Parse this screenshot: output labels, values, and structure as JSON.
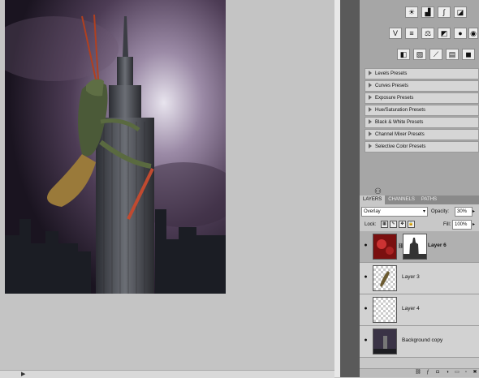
{
  "adjustments": {
    "row1": [
      "brightness-icon",
      "levels-icon",
      "curves-icon",
      "exposure-icon"
    ],
    "row2": [
      "vibrance-icon",
      "hue-saturation-icon",
      "color-balance-icon",
      "black-white-icon",
      "photo-filter-icon",
      "channel-mixer-icon"
    ],
    "row3": [
      "invert-icon",
      "posterize-icon",
      "threshold-icon",
      "gradient-map-icon",
      "selective-color-icon"
    ],
    "presets": [
      "Levels Presets",
      "Curves Presets",
      "Exposure Presets",
      "Hue/Saturation Presets",
      "Black & White Presets",
      "Channel Mixer Presets",
      "Selective Color Presets"
    ]
  },
  "layers_panel": {
    "tabs": [
      "LAYERS",
      "CHANNELS",
      "PATHS"
    ],
    "blend_mode": "Overlay",
    "opacity_label": "Opacity:",
    "opacity_value": "30%",
    "lock_label": "Lock:",
    "fill_label": "Fill:",
    "fill_value": "100%",
    "layers": [
      {
        "name": "Layer 6",
        "selected": true
      },
      {
        "name": "Layer 3",
        "selected": false
      },
      {
        "name": "Layer 4",
        "selected": false
      },
      {
        "name": "Background copy",
        "selected": false
      }
    ]
  },
  "colors": {
    "panel_bg": "#a6a6a6",
    "canvas_bg": "#c4c4c4",
    "selected_layer": "#b0b0b0"
  }
}
